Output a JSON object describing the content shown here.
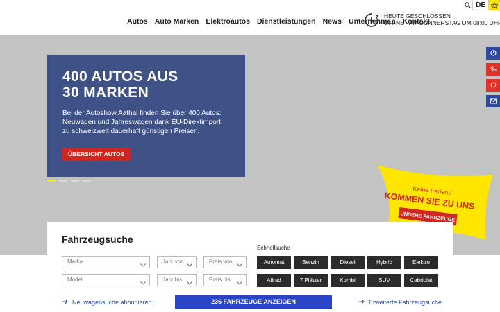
{
  "header": {
    "language": "DE",
    "nav": [
      "Autos",
      "Auto Marken",
      "Elektroautos",
      "Dienstleistungen",
      "News",
      "Unternehmen",
      "Kontakt"
    ],
    "hours_line1": "HEUTE GESCHLOSSEN",
    "hours_line2": "ÖFFNET AM DONNERSTAG UM 08:00 UHR"
  },
  "hero": {
    "title_line1": "400 AUTOS AUS",
    "title_line2": "30 MARKEN",
    "text": "Bei der Autoshow Aathal finden Sie über 400 Autos: Neuwagen und Jahreswagen dank EU-Direktimport zu schweizweit dauerhaft günstigen Preisen.",
    "button": "ÜBERSICHT AUTOS"
  },
  "promo": {
    "line1": "Keine Ferien?",
    "line2": "KOMMEN SIE ZU UNS",
    "button": "UNSERE FAHRZEUGE"
  },
  "search": {
    "title": "Fahrzeugsuche",
    "marke": "Marke",
    "modell": "Modell",
    "jahr_von": "Jahr von",
    "jahr_bis": "Jahr bis",
    "preis_von": "Preis von",
    "preis_bis": "Preis bis",
    "quick_title": "Schnellsuche",
    "quick": [
      "Automat",
      "Benzin",
      "Diesel",
      "Hybrid",
      "Elektro",
      "Allrad",
      "7 Plätzer",
      "Kombi",
      "SUV",
      "Cabriolet"
    ],
    "subscribe": "Neuwagensuche abonnieren",
    "show_button": "236 FAHRZEUGE ANZEIGEN",
    "advanced": "Erweiterte Fahrzeugsuche"
  },
  "colors": {
    "accent_yellow": "#ffe600",
    "hero_blue": "#3f5288",
    "cta_red": "#d0261f",
    "primary_blue": "#2944c7"
  }
}
